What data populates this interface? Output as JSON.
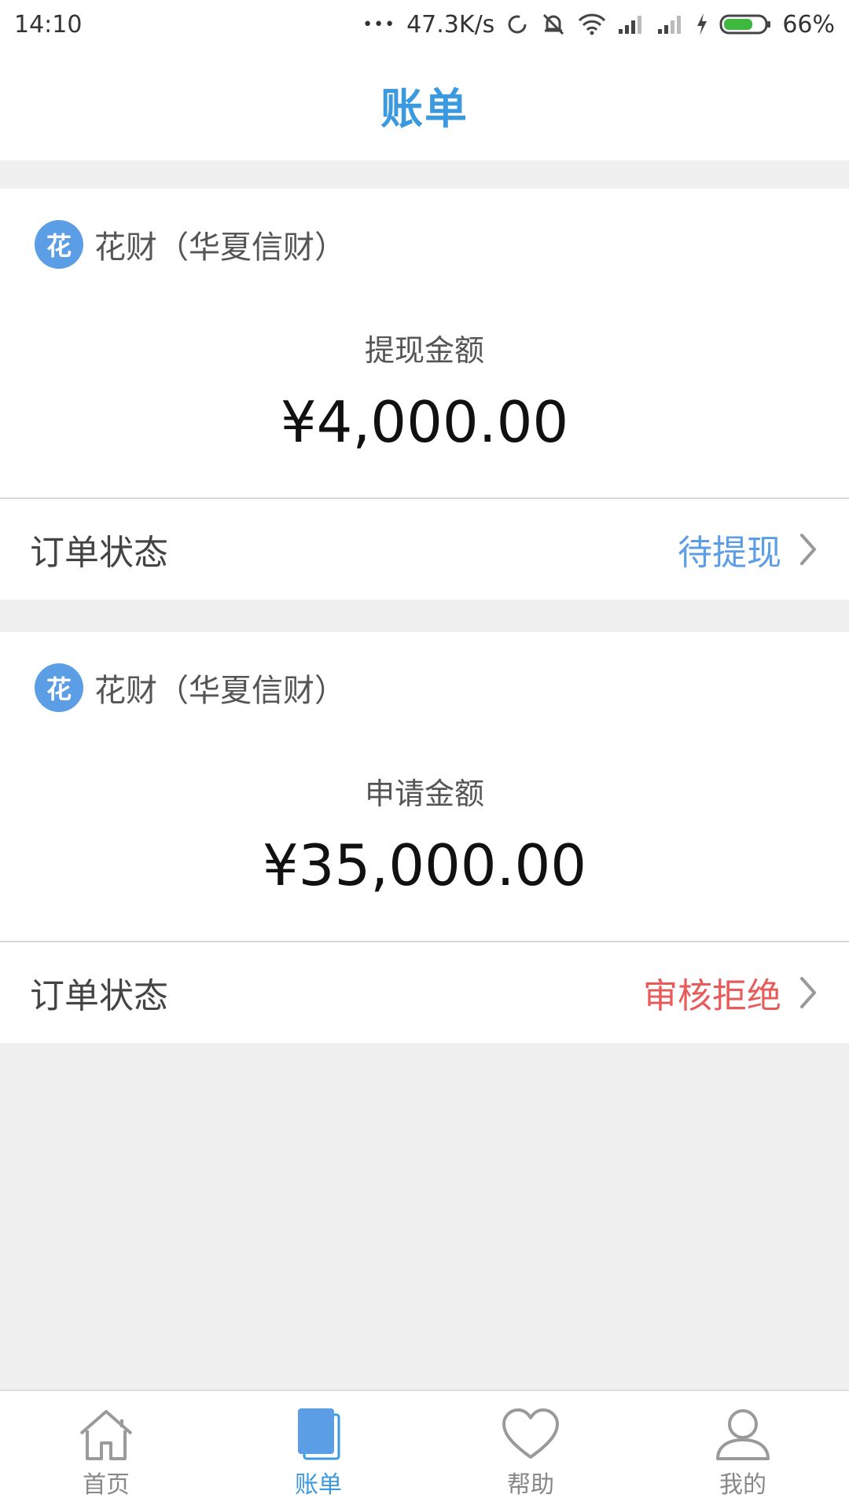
{
  "status_bar": {
    "time": "14:10",
    "dots": "•••",
    "net_speed": "47.3K/s",
    "battery": "66%"
  },
  "header": {
    "title": "账单"
  },
  "colors": {
    "accent": "#3b99e0",
    "pending": "#5b9ee6",
    "rejected": "#e85b5b"
  },
  "orders": [
    {
      "logo_char": "花",
      "lender": "花财（华夏信财）",
      "amount_label": "提现金额",
      "amount": "¥4,000.00",
      "status_label": "订单状态",
      "status": "待提现"
    },
    {
      "logo_char": "花",
      "lender": "花财（华夏信财）",
      "amount_label": "申请金额",
      "amount": "¥35,000.00",
      "status_label": "订单状态",
      "status": "审核拒绝"
    }
  ],
  "tabs": [
    {
      "label": "首页",
      "icon": "home-icon"
    },
    {
      "label": "账单",
      "icon": "bill-icon"
    },
    {
      "label": "帮助",
      "icon": "heart-icon"
    },
    {
      "label": "我的",
      "icon": "user-icon"
    }
  ]
}
